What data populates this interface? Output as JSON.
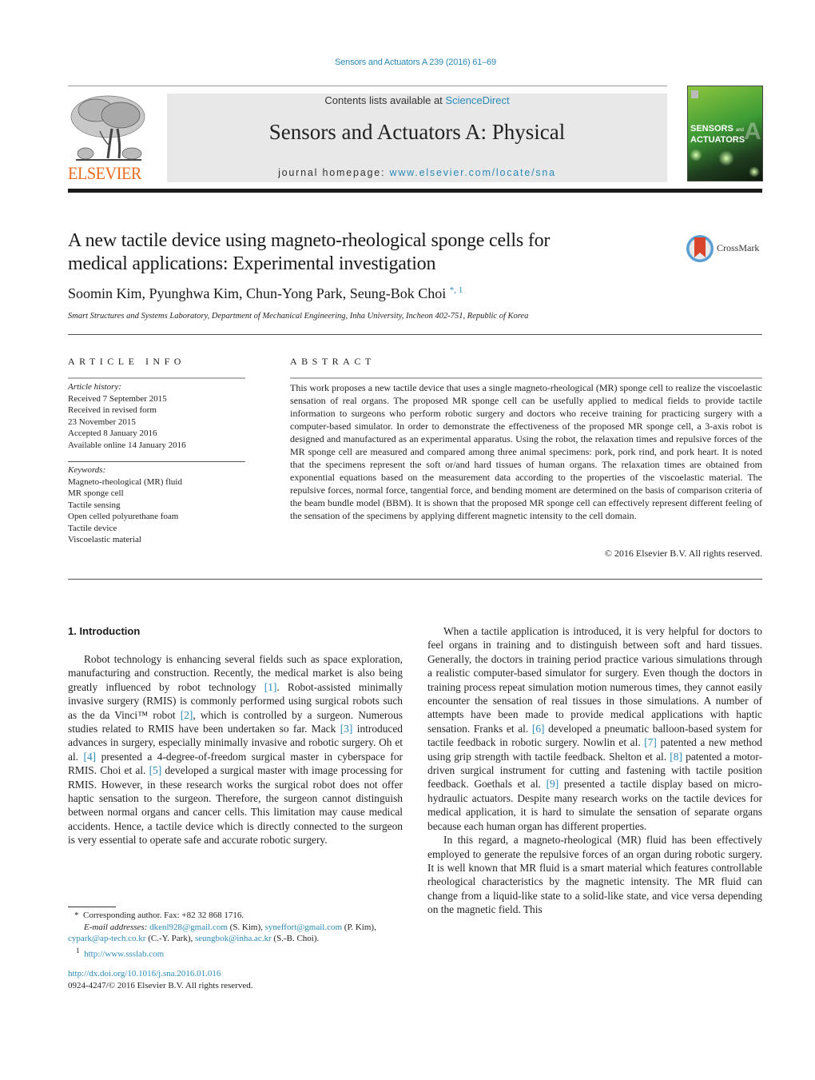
{
  "header": {
    "citation": "Sensors and Actuators A 239 (2016) 61–69",
    "publisher_logo_text": "ELSEVIER",
    "contents_prefix": "Contents lists available at ",
    "contents_link": "ScienceDirect",
    "journal_name": "Sensors and Actuators A: Physical",
    "homepage_prefix": "journal homepage: ",
    "homepage_link": "www.elsevier.com/locate/sna",
    "cover_title_1": "SENSORS",
    "cover_title_and": "and",
    "cover_title_2": "ACTUATORS",
    "cover_letter": "A",
    "brand_color": "#ea6b1f",
    "link_color": "#2a8ab8"
  },
  "article": {
    "title_line1": "A new tactile device using magneto-rheological sponge cells for",
    "title_line2": "medical applications: Experimental investigation",
    "crossmark_label": "CrossMark",
    "authors": "Soomin Kim, Pyunghwa Kim, Chun-Yong Park, Seung-Bok Choi",
    "author_marks": "*, 1",
    "affiliation": "Smart Structures and Systems Laboratory, Department of Mechanical Engineering, Inha University, Incheon 402-751, Republic of Korea"
  },
  "article_info": {
    "heading": "ARTICLE INFO",
    "history_label": "Article history:",
    "history": [
      "Received 7 September 2015",
      "Received in revised form",
      "23 November 2015",
      "Accepted 8 January 2016",
      "Available online 14 January 2016"
    ],
    "keywords_label": "Keywords:",
    "keywords": [
      "Magneto-rheological (MR) fluid",
      "MR sponge cell",
      "Tactile sensing",
      "Open celled polyurethane foam",
      "Tactile device",
      "Viscoelastic material"
    ]
  },
  "abstract": {
    "heading": "ABSTRACT",
    "text": "This work proposes a new tactile device that uses a single magneto-rheological (MR) sponge cell to realize the viscoelastic sensation of real organs. The proposed MR sponge cell can be usefully applied to medical fields to provide tactile information to surgeons who perform robotic surgery and doctors who receive training for practicing surgery with a computer-based simulator. In order to demonstrate the effectiveness of the proposed MR sponge cell, a 3-axis robot is designed and manufactured as an experimental apparatus. Using the robot, the relaxation times and repulsive forces of the MR sponge cell are measured and compared among three animal specimens: pork, pork rind, and pork heart. It is noted that the specimens represent the soft or/and hard tissues of human organs. The relaxation times are obtained from exponential equations based on the measurement data according to the properties of the viscoelastic material. The repulsive forces, normal force, tangential force, and bending moment are determined on the basis of comparison criteria of the beam bundle model (BBM). It is shown that the proposed MR sponge cell can effectively represent different feeling of the sensation of the specimens by applying different magnetic intensity to the cell domain.",
    "copyright": "© 2016 Elsevier B.V. All rights reserved."
  },
  "body": {
    "section_heading": "1.  Introduction",
    "left_paragraph": [
      {
        "t": "Robot technology is enhancing several fields such as space exploration, manufacturing and construction. Recently, the medical market is also being greatly influenced by robot technology "
      },
      {
        "ref": "[1]"
      },
      {
        "t": ". Robot-assisted minimally invasive surgery (RMIS) is commonly performed using surgical robots such as the da Vinci™ robot "
      },
      {
        "ref": "[2]"
      },
      {
        "t": ", which is controlled by a surgeon. Numerous studies related to RMIS have been undertaken so far. Mack "
      },
      {
        "ref": "[3]"
      },
      {
        "t": " introduced advances in surgery, especially minimally invasive and robotic surgery. Oh et al. "
      },
      {
        "ref": "[4]"
      },
      {
        "t": " presented a 4-degree-of-freedom surgical master in cyberspace for RMIS. Choi et al. "
      },
      {
        "ref": "[5]"
      },
      {
        "t": " developed a surgical master with image processing for RMIS. However, in these research works the surgical robot does not offer haptic sensation to the surgeon. Therefore, the surgeon cannot distinguish between normal organs and cancer cells. This limitation may cause medical accidents. Hence, a tactile device which is directly connected to the surgeon is very essential to operate safe and accurate robotic surgery."
      }
    ],
    "right_paragraph_1": [
      {
        "t": "When a tactile application is introduced, it is very helpful for doctors to feel organs in training and to distinguish between soft and hard tissues. Generally, the doctors in training period practice various simulations through a realistic computer-based simulator for surgery. Even though the doctors in training process repeat simulation motion numerous times, they cannot easily encounter the sensation of real tissues in those simulations. A number of attempts have been made to provide medical applications with haptic sensation. Franks et al. "
      },
      {
        "ref": "[6]"
      },
      {
        "t": " developed a pneumatic balloon-based system for tactile feedback in robotic surgery. Nowlin et al. "
      },
      {
        "ref": "[7]"
      },
      {
        "t": " patented a new method using grip strength with tactile feedback. Shelton et al. "
      },
      {
        "ref": "[8]"
      },
      {
        "t": " patented a motor-driven surgical instrument for cutting and fastening with tactile position feedback. Goethals et al. "
      },
      {
        "ref": "[9]"
      },
      {
        "t": " presented a tactile display based on micro-hydraulic actuators. Despite many research works on the tactile devices for medical application, it is hard to simulate the sensation of separate organs because each human organ has different properties."
      }
    ],
    "right_paragraph_2": [
      {
        "t": "In this regard, a magneto-rheological (MR) fluid has been effectively employed to generate the repulsive forces of an organ during robotic surgery. It is well known that MR fluid is a smart material which features controllable rheological characteristics by the magnetic intensity. The MR fluid can change from a liquid-like state to a solid-like state, and vice versa depending on the magnetic field. This"
      }
    ]
  },
  "footnotes": {
    "corresponding_mark": "*",
    "corresponding": "Corresponding author. Fax: +82 32 868 1716.",
    "email_label": "E-mail addresses:",
    "emails": [
      {
        "address": "dkenl928@gmail.com",
        "who": " (S. Kim), "
      },
      {
        "address": "syneffort@gmail.com",
        "who": " (P. Kim), "
      },
      {
        "address": "cypark@ap-tech.co.kr",
        "who": " (C.-Y. Park), "
      },
      {
        "address": "seungbok@inha.ac.kr",
        "who": " (S.-B. Choi)."
      }
    ],
    "note1_mark": "1",
    "note1_link": "http://www.ssslab.com",
    "doi": "http://dx.doi.org/10.1016/j.sna.2016.01.016",
    "issn_copyright": "0924-4247/© 2016 Elsevier B.V. All rights reserved."
  }
}
